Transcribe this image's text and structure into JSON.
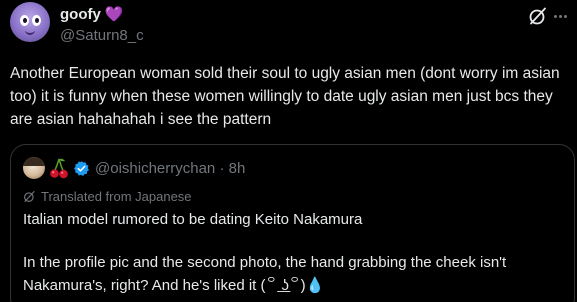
{
  "post": {
    "display_name": "goofy",
    "name_emoji": "💜",
    "handle": "@Saturn8_c",
    "text": "Another European woman sold their soul to ugly asian men (dont worry im asian too) it is funny when these women willingly to date ugly asian men just bcs they are asian hahahahah i see the pattern"
  },
  "quote": {
    "meta": "@oishicherrychan · 8h",
    "translated_label": "Translated from Japanese",
    "line1": "Italian model rumored to be dating Keito Nakamura",
    "line2": "In the profile pic and the second photo, the hand grabbing the cheek isn't Nakamura's, right? And he's liked it (꒪ ͟ʖ꒪)💧"
  },
  "icons": {
    "avatar": "avatar",
    "grok": "grok-icon",
    "more": "more-icon",
    "cherry": "cherry-icon",
    "verified": "verified-badge-icon",
    "translate": "translate-icon"
  },
  "colors": {
    "background": "#000000",
    "text": "#e7e9ea",
    "secondary": "#71767b",
    "border": "#2f3336",
    "verified": "#1d9bf0",
    "heart": "#b48cf2"
  }
}
